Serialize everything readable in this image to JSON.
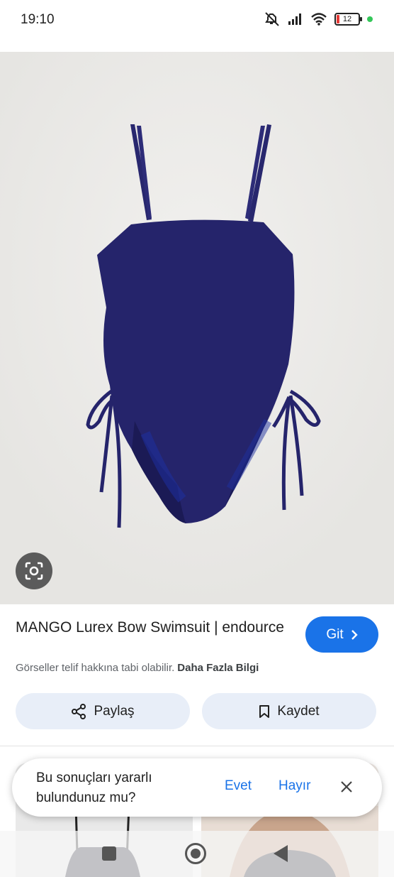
{
  "status_bar": {
    "time": "19:10",
    "battery_level": "12",
    "icons": [
      "mute-icon",
      "signal-icon",
      "wifi-icon",
      "battery-icon",
      "privacy-dot-icon"
    ]
  },
  "result": {
    "title": "MANGO Lurex Bow Swimsuit | endource",
    "visit_label": "Git",
    "copyright_text": "Görseller telif hakkına tabi olabilir.",
    "more_info": "Daha Fazla Bilgi"
  },
  "actions": {
    "share_label": "Paylaş",
    "save_label": "Kaydet"
  },
  "feedback": {
    "question": "Bu sonuçları yararlı bulundunuz mu?",
    "yes_label": "Evet",
    "no_label": "Hayır"
  },
  "colors": {
    "accent": "#1a73e8",
    "action_bg": "#e8eef8",
    "image_bg": "#ebeae8",
    "swimsuit": "#25246b"
  }
}
